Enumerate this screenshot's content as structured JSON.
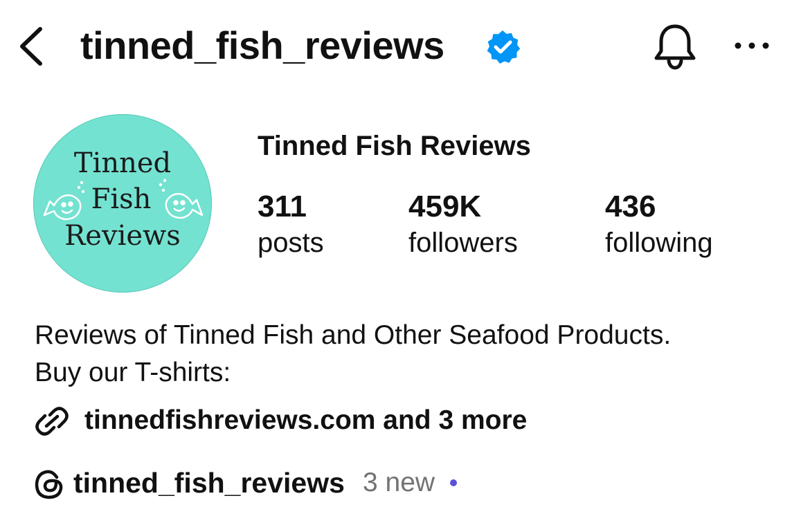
{
  "header": {
    "username": "tinned_fish_reviews",
    "icons": {
      "back": "chevron-left-icon",
      "verified": "verified-badge-icon",
      "notifications": "bell-icon",
      "more": "ellipsis-icon"
    }
  },
  "avatar": {
    "logo_lines": [
      "Tinned",
      "Fish",
      "Reviews"
    ]
  },
  "profile": {
    "display_name": "Tinned Fish Reviews",
    "stats": [
      {
        "value": "311",
        "label": "posts"
      },
      {
        "value": "459K",
        "label": "followers"
      },
      {
        "value": "436",
        "label": "following"
      }
    ]
  },
  "bio": {
    "lines": [
      "Reviews of Tinned Fish and Other Seafood Products.",
      "Buy our T-shirts:"
    ]
  },
  "link": {
    "icon": "link-icon",
    "text": "tinnedfishreviews.com and 3 more"
  },
  "threads": {
    "icon": "threads-icon",
    "handle": "tinned_fish_reviews",
    "new_label": "3 new"
  },
  "colors": {
    "verified_blue": "#0095f6",
    "avatar_bg": "#74e2d1",
    "new_dot": "#5b51d8",
    "muted_text": "#737373"
  }
}
